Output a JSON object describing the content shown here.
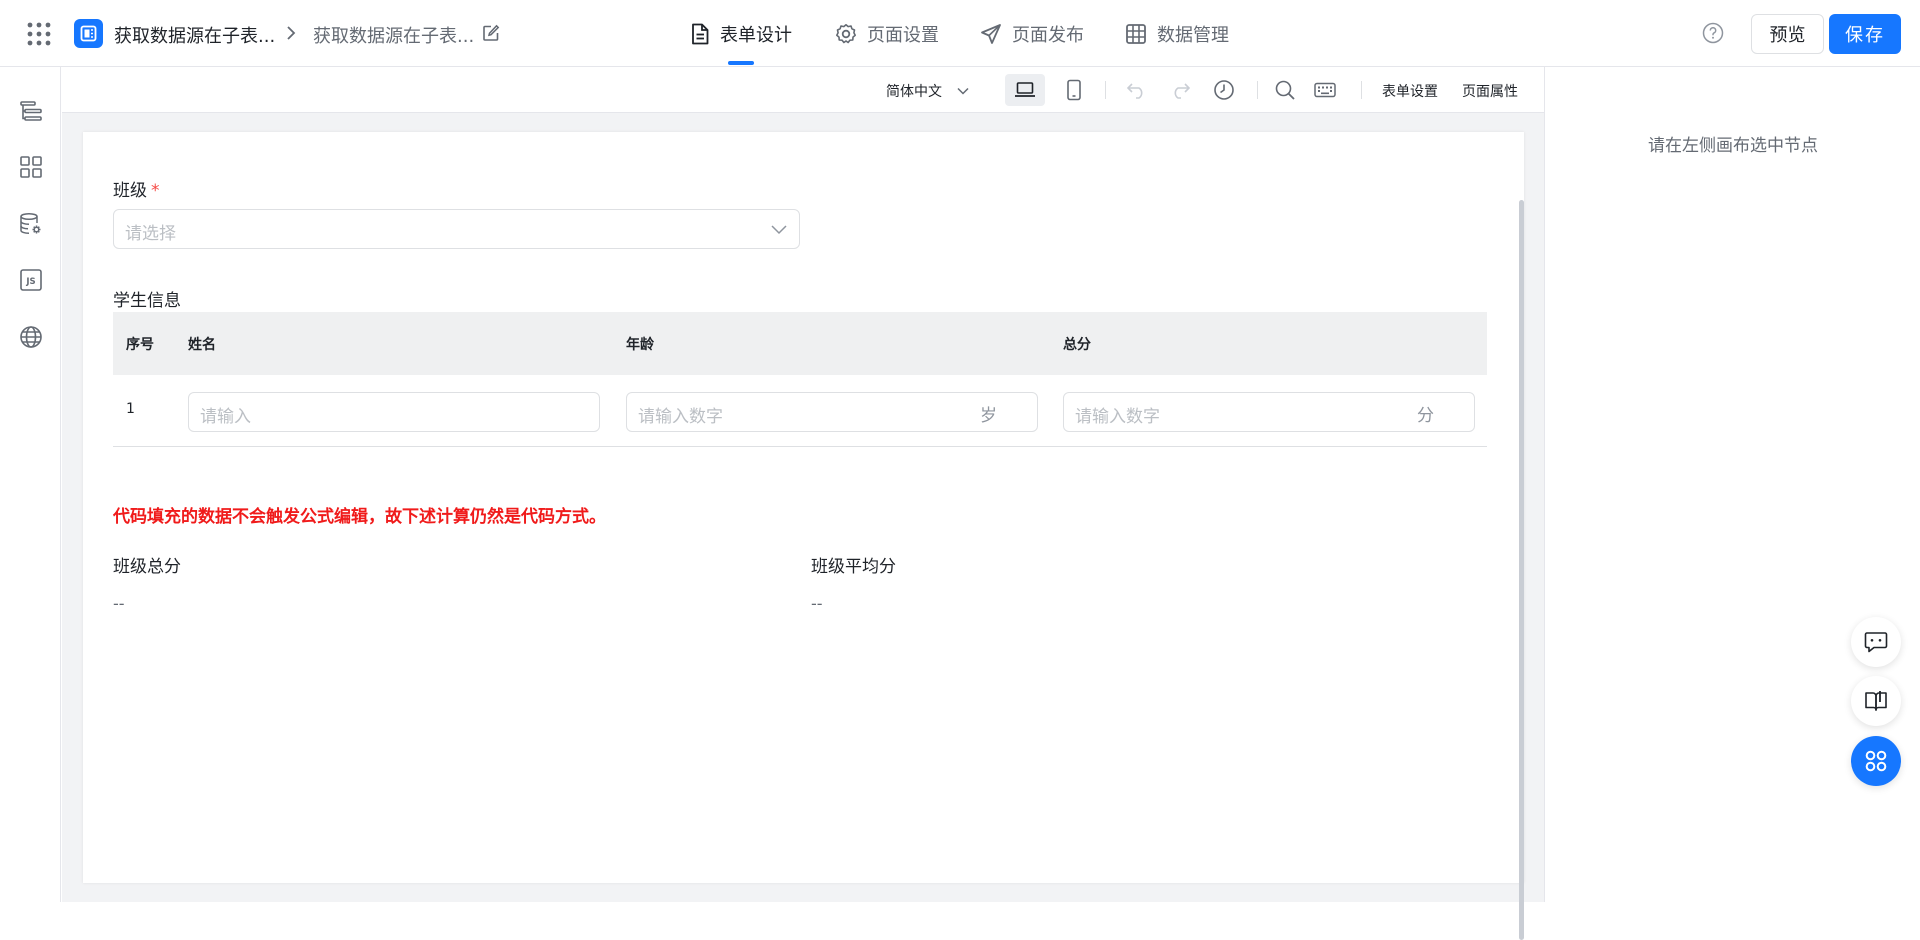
{
  "header": {
    "app_name": "获取数据源在子表...",
    "page_name": "获取数据源在子表...",
    "tabs": [
      {
        "label": "表单设计",
        "icon": "document-icon",
        "active": true
      },
      {
        "label": "页面设置",
        "icon": "gear-icon",
        "active": false
      },
      {
        "label": "页面发布",
        "icon": "send-icon",
        "active": false
      },
      {
        "label": "数据管理",
        "icon": "table-icon",
        "active": false
      }
    ],
    "preview_label": "预览",
    "save_label": "保存"
  },
  "sidebar": {
    "items": [
      {
        "icon": "outline-tree-icon"
      },
      {
        "icon": "components-grid-icon"
      },
      {
        "icon": "datasource-icon"
      },
      {
        "icon": "js-code-icon"
      },
      {
        "icon": "globe-icon"
      }
    ]
  },
  "toolbar": {
    "language": "简体中文",
    "form_settings": "表单设置",
    "page_properties": "页面属性"
  },
  "form": {
    "class_field": {
      "label": "班级",
      "required_mark": "*",
      "placeholder": "请选择"
    },
    "student_table": {
      "title": "学生信息",
      "columns": [
        "序号",
        "姓名",
        "年龄",
        "总分"
      ],
      "rows": [
        {
          "index": "1",
          "name_placeholder": "请输入",
          "age_placeholder": "请输入数字",
          "age_suffix": "岁",
          "score_placeholder": "请输入数字",
          "score_suffix": "分"
        }
      ]
    },
    "notice": "代码填充的数据不会触发公式编辑，故下述计算仍然是代码方式。",
    "class_total": {
      "label": "班级总分",
      "value": "--"
    },
    "class_average": {
      "label": "班级平均分",
      "value": "--"
    }
  },
  "right_panel": {
    "hint": "请在左侧画布选中节点"
  },
  "colors": {
    "primary": "#1677ff",
    "notice_red": "#f01b1b",
    "required_red": "#f54a45"
  }
}
